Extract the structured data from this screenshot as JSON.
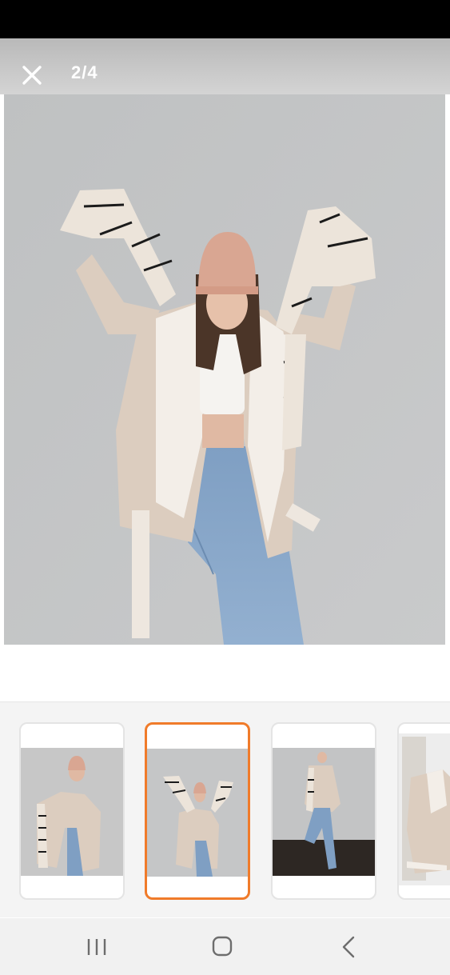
{
  "viewer": {
    "counter": "2/4",
    "close_icon": "close-icon"
  },
  "thumbnails": [
    {
      "icon": "photo-thumbnail",
      "selected": false
    },
    {
      "icon": "photo-thumbnail",
      "selected": true
    },
    {
      "icon": "photo-thumbnail",
      "selected": false
    },
    {
      "icon": "photo-thumbnail",
      "selected": false
    }
  ],
  "navigation": {
    "recents_icon": "recent-apps-icon",
    "home_icon": "home-icon",
    "back_icon": "back-icon"
  },
  "colors": {
    "accent": "#f07b2a",
    "status_bar": "#000000",
    "nav_bar": "#f1f1f1",
    "thumb_strip": "#f4f4f4"
  }
}
